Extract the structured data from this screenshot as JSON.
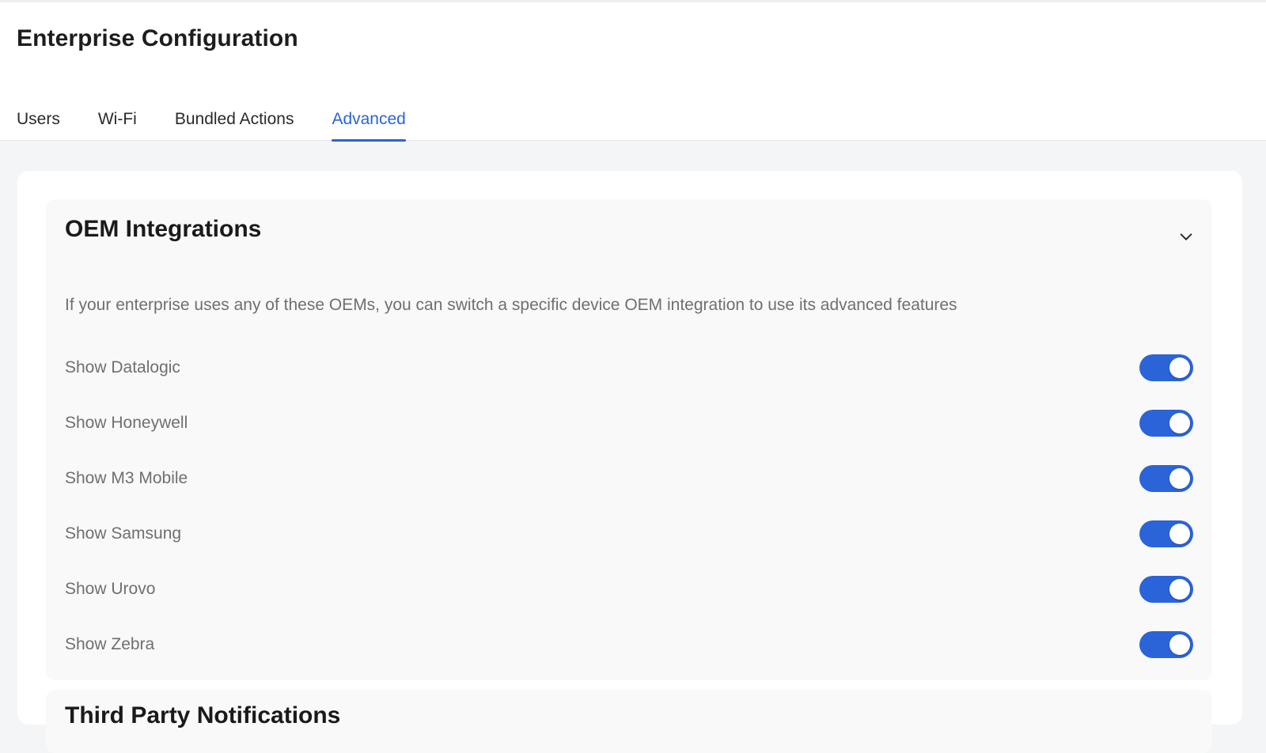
{
  "header": {
    "title": "Enterprise Configuration"
  },
  "tabs": [
    {
      "label": "Users",
      "active": false
    },
    {
      "label": "Wi-Fi",
      "active": false
    },
    {
      "label": "Bundled Actions",
      "active": false
    },
    {
      "label": "Advanced",
      "active": true
    }
  ],
  "oem_section": {
    "title": "OEM Integrations",
    "expanded": true,
    "description": "If your enterprise uses any of these OEMs, you can switch a specific device OEM integration to use its advanced features",
    "items": [
      {
        "label": "Show Datalogic",
        "enabled": true
      },
      {
        "label": "Show Honeywell",
        "enabled": true
      },
      {
        "label": "Show M3 Mobile",
        "enabled": true
      },
      {
        "label": "Show Samsung",
        "enabled": true
      },
      {
        "label": "Show Urovo",
        "enabled": true
      },
      {
        "label": "Show Zebra",
        "enabled": true
      }
    ]
  },
  "next_section": {
    "title": "Third Party Notifications"
  },
  "colors": {
    "accent": "#2b63d9",
    "toggle_off": "#c9ccd1",
    "page_bg": "#f4f5f7",
    "section_bg": "#f9f9f9"
  },
  "icons": {
    "collapse": "chevron-down-icon"
  }
}
